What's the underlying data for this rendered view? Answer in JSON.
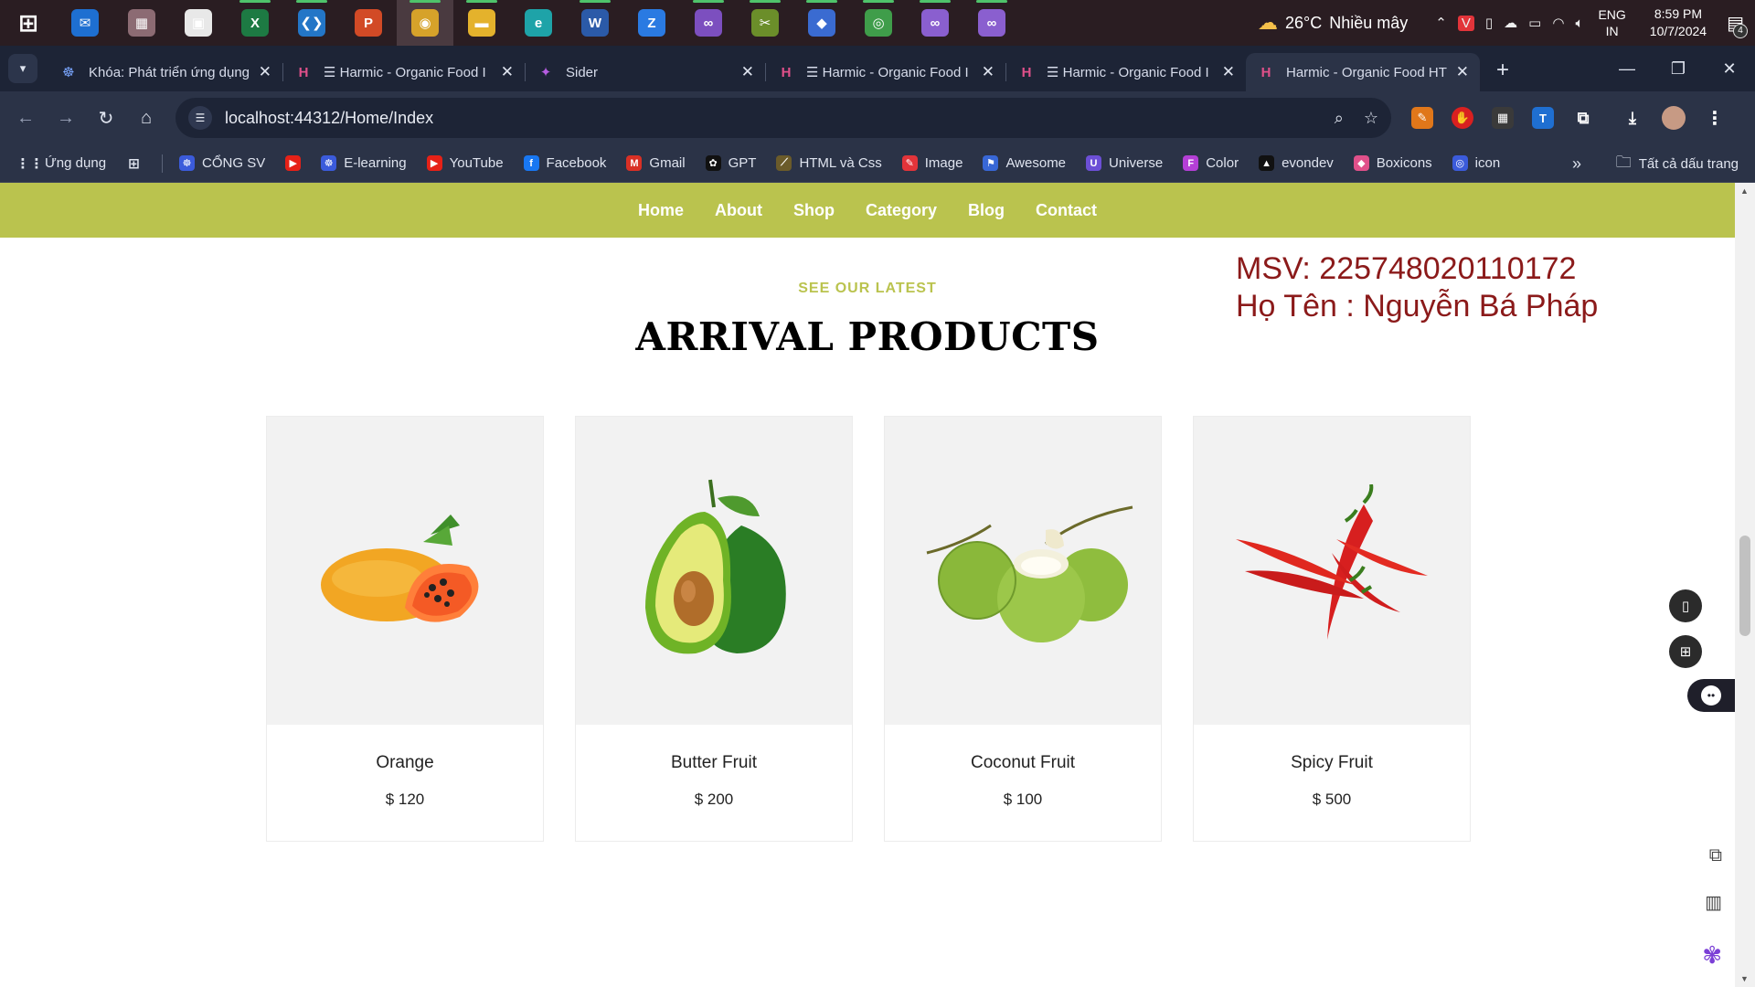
{
  "taskbar": {
    "apps": [
      {
        "icon": "windows-start-icon",
        "glyph": "⊞",
        "bg": "transparent"
      },
      {
        "icon": "mail-icon",
        "glyph": "✉",
        "bg": "#1e6fd1"
      },
      {
        "icon": "sticky-app-icon",
        "glyph": "▦",
        "bg": "#8c6b73"
      },
      {
        "icon": "store-icon",
        "glyph": "▣",
        "bg": "#e8e8e8"
      },
      {
        "icon": "excel-icon",
        "glyph": "X",
        "bg": "#1d7a43"
      },
      {
        "icon": "vscode-icon",
        "glyph": "❮❯",
        "bg": "#2376c7"
      },
      {
        "icon": "powerpoint-icon",
        "glyph": "P",
        "bg": "#d24a26"
      },
      {
        "icon": "chrome-icon",
        "glyph": "◉",
        "bg": "#d6a22a"
      },
      {
        "icon": "file-explorer-icon",
        "glyph": "▬",
        "bg": "#e4b22c"
      },
      {
        "icon": "edge-icon",
        "glyph": "e",
        "bg": "#1ea3a8"
      },
      {
        "icon": "word-icon",
        "glyph": "W",
        "bg": "#2b5aa8"
      },
      {
        "icon": "zalo-icon",
        "glyph": "Z",
        "bg": "#2a7ae2"
      },
      {
        "icon": "visual-studio-icon",
        "glyph": "∞",
        "bg": "#7c4fbf"
      },
      {
        "icon": "snipping-tool-icon",
        "glyph": "✂",
        "bg": "#6b8e2a"
      },
      {
        "icon": "git-icon",
        "glyph": "◆",
        "bg": "#3a6bd1"
      },
      {
        "icon": "copilot-icon",
        "glyph": "◎",
        "bg": "#3f9d4a"
      },
      {
        "icon": "visual-studio-preview-icon",
        "glyph": "∞",
        "bg": "#8a5fcf"
      },
      {
        "icon": "visual-studio-preview-2-icon",
        "glyph": "∞",
        "bg": "#8a5fcf"
      }
    ],
    "weather_temp": "26°C",
    "weather_desc": "Nhiều mây",
    "lang_top": "ENG",
    "lang_bottom": "IN",
    "time": "8:59 PM",
    "date": "10/7/2024",
    "notification_count": "4"
  },
  "tabs": [
    {
      "title": "Khóa: Phát triển ứng dụng",
      "fav": "☸",
      "fav_color": "#7aa6ff",
      "width": 256
    },
    {
      "title": "☰ Harmic - Organic Food I",
      "fav": "H",
      "fav_color": "#e0508a",
      "width": 264
    },
    {
      "title": "Sider",
      "fav": "✦",
      "fav_color": "#b55ce0",
      "width": 262
    },
    {
      "title": "☰ Harmic - Organic Food I",
      "fav": "H",
      "fav_color": "#e0508a",
      "width": 262
    },
    {
      "title": "☰ Harmic - Organic Food I",
      "fav": "H",
      "fav_color": "#e0508a",
      "width": 262
    },
    {
      "title": "Harmic - Organic Food HT",
      "fav": "H",
      "fav_color": "#e0508a",
      "width": 256
    }
  ],
  "address": {
    "url": "localhost:44312/Home/Index"
  },
  "bookmarks": [
    {
      "label": "Ứng dụng",
      "icon": "apps-grid-icon",
      "glyph": "⋮⋮",
      "bg": "transparent"
    },
    {
      "label": "",
      "icon": "tab-groups-icon",
      "glyph": "⊞",
      "bg": "transparent"
    },
    {
      "label": "CỔNG SV",
      "icon": "portal-icon",
      "glyph": "☸",
      "bg": "#3b5bdb"
    },
    {
      "label": "",
      "icon": "youtube-icon",
      "glyph": "▶",
      "bg": "#e62117"
    },
    {
      "label": "E-learning",
      "icon": "elearning-icon",
      "glyph": "☸",
      "bg": "#3b5bdb"
    },
    {
      "label": "YouTube",
      "icon": "youtube-icon",
      "glyph": "▶",
      "bg": "#e62117"
    },
    {
      "label": "Facebook",
      "icon": "facebook-icon",
      "glyph": "f",
      "bg": "#1877f2"
    },
    {
      "label": "Gmail",
      "icon": "gmail-icon",
      "glyph": "M",
      "bg": "#d93025"
    },
    {
      "label": "GPT",
      "icon": "openai-icon",
      "glyph": "✿",
      "bg": "#111"
    },
    {
      "label": "HTML và Css",
      "icon": "html-icon",
      "glyph": "⟋",
      "bg": "#6b5b2a"
    },
    {
      "label": "Image",
      "icon": "image-icon",
      "glyph": "✎",
      "bg": "#e2343a"
    },
    {
      "label": "Awesome",
      "icon": "flag-icon",
      "glyph": "⚑",
      "bg": "#3867d6"
    },
    {
      "label": "Universe",
      "icon": "universe-icon",
      "glyph": "U",
      "bg": "#6c4fd6"
    },
    {
      "label": "Color",
      "icon": "color-icon",
      "glyph": "F",
      "bg": "#b43fd6"
    },
    {
      "label": "evondev",
      "icon": "evondev-icon",
      "glyph": "▲",
      "bg": "#111"
    },
    {
      "label": "Boxicons",
      "icon": "boxicons-icon",
      "glyph": "◆",
      "bg": "#e0508a"
    },
    {
      "label": "icon",
      "icon": "icon-site-icon",
      "glyph": "◎",
      "bg": "#3b5bdb"
    }
  ],
  "bookmarks_more": "»",
  "all_bookmarks": "Tất cả dấu trang",
  "site": {
    "nav": [
      "Home",
      "About",
      "Shop",
      "Category",
      "Blog",
      "Contact"
    ],
    "eyebrow": "SEE OUR LATEST",
    "headline": "ARRIVAL PRODUCTS",
    "student_id": "MSV: 225748020110172",
    "student_name": "Họ Tên : Nguyễn Bá Pháp",
    "products": [
      {
        "name": "Orange",
        "price": "$ 120",
        "image": "papaya-image"
      },
      {
        "name": "Butter Fruit",
        "price": "$ 200",
        "image": "avocado-image"
      },
      {
        "name": "Coconut Fruit",
        "price": "$ 100",
        "image": "coconut-image"
      },
      {
        "name": "Spicy Fruit",
        "price": "$ 500",
        "image": "chili-image"
      }
    ]
  },
  "colors": {
    "brand": "#bac34e",
    "student_text": "#8b1a1a",
    "taskbar_bg": "#2a1d22",
    "browser_bg": "#2b3347"
  }
}
